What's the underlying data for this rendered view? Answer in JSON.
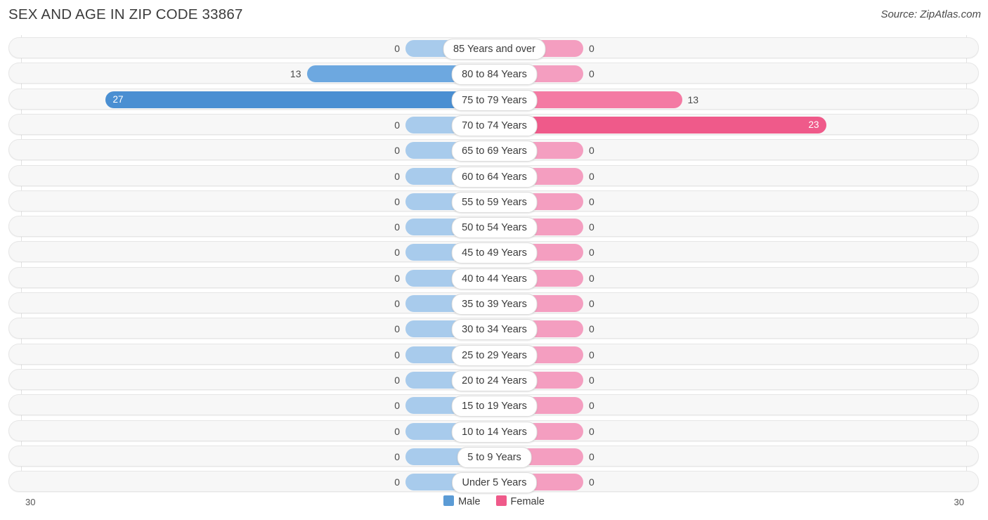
{
  "header": {
    "title": "SEX AND AGE IN ZIP CODE 33867",
    "source": "Source: ZipAtlas.com"
  },
  "legend": {
    "items": [
      {
        "label": "Male",
        "color": "#5b9bd5"
      },
      {
        "label": "Female",
        "color": "#ef5a8a"
      }
    ]
  },
  "axis": {
    "left_label": "30",
    "right_label": "30",
    "max": 30
  },
  "chart_data": {
    "type": "bar",
    "subtype": "population-pyramid",
    "title": "SEX AND AGE IN ZIP CODE 33867",
    "xlabel": "",
    "ylabel": "",
    "xlim": [
      -30,
      30
    ],
    "grid": true,
    "legend_position": "bottom-center",
    "categories": [
      "85 Years and over",
      "80 to 84 Years",
      "75 to 79 Years",
      "70 to 74 Years",
      "65 to 69 Years",
      "60 to 64 Years",
      "55 to 59 Years",
      "50 to 54 Years",
      "45 to 49 Years",
      "40 to 44 Years",
      "35 to 39 Years",
      "30 to 34 Years",
      "25 to 29 Years",
      "20 to 24 Years",
      "15 to 19 Years",
      "10 to 14 Years",
      "5 to 9 Years",
      "Under 5 Years"
    ],
    "series": [
      {
        "name": "Male",
        "color": "#5b9bd5",
        "values": [
          0,
          13,
          27,
          0,
          0,
          0,
          0,
          0,
          0,
          0,
          0,
          0,
          0,
          0,
          0,
          0,
          0,
          0
        ]
      },
      {
        "name": "Female",
        "color": "#ef5a8a",
        "values": [
          0,
          0,
          13,
          23,
          0,
          0,
          0,
          0,
          0,
          0,
          0,
          0,
          0,
          0,
          0,
          0,
          0,
          0
        ]
      }
    ]
  },
  "rows": [
    {
      "age": "85 Years and over",
      "male": "0",
      "female": "0"
    },
    {
      "age": "80 to 84 Years",
      "male": "13",
      "female": "0"
    },
    {
      "age": "75 to 79 Years",
      "male": "27",
      "female": "13"
    },
    {
      "age": "70 to 74 Years",
      "male": "0",
      "female": "23"
    },
    {
      "age": "65 to 69 Years",
      "male": "0",
      "female": "0"
    },
    {
      "age": "60 to 64 Years",
      "male": "0",
      "female": "0"
    },
    {
      "age": "55 to 59 Years",
      "male": "0",
      "female": "0"
    },
    {
      "age": "50 to 54 Years",
      "male": "0",
      "female": "0"
    },
    {
      "age": "45 to 49 Years",
      "male": "0",
      "female": "0"
    },
    {
      "age": "40 to 44 Years",
      "male": "0",
      "female": "0"
    },
    {
      "age": "35 to 39 Years",
      "male": "0",
      "female": "0"
    },
    {
      "age": "30 to 34 Years",
      "male": "0",
      "female": "0"
    },
    {
      "age": "25 to 29 Years",
      "male": "0",
      "female": "0"
    },
    {
      "age": "20 to 24 Years",
      "male": "0",
      "female": "0"
    },
    {
      "age": "15 to 19 Years",
      "male": "0",
      "female": "0"
    },
    {
      "age": "10 to 14 Years",
      "male": "0",
      "female": "0"
    },
    {
      "age": "5 to 9 Years",
      "male": "0",
      "female": "0"
    },
    {
      "age": "Under 5 Years",
      "male": "0",
      "female": "0"
    }
  ]
}
